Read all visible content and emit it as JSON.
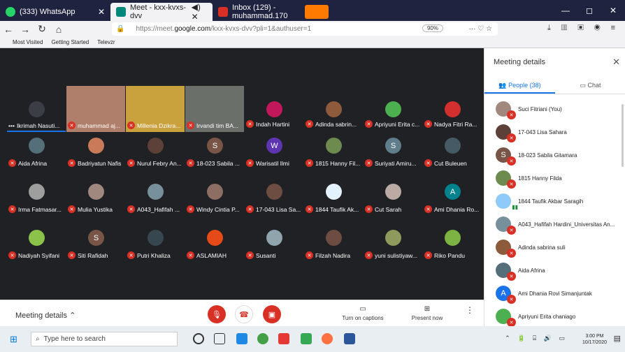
{
  "browser": {
    "tabs": [
      {
        "label": "(333) WhatsApp",
        "color": "#25d366"
      },
      {
        "label": "Meet - kxx-kvxs-dvv",
        "color": "#00897b"
      },
      {
        "label": "Inbox (129) - muhammad.170",
        "color": "#d93025"
      }
    ],
    "url_prefix": "https://meet.",
    "url_domain": "google.com",
    "url_suffix": "/kxx-kvxs-dvv?pli=1&authuser=1",
    "zoom": "90%",
    "bookmarks": [
      "Most Visited",
      "Getting Started",
      "Televzr"
    ]
  },
  "meeting": {
    "videos": [
      {
        "name": "Ikrimah Nasuti...",
        "color": "#3b3f45"
      },
      {
        "name": "muhammad aj...",
        "color": "#b07f6b"
      },
      {
        "name": "Millenia Dzikra...",
        "color": "#c9a23e"
      },
      {
        "name": "Irvandi tim BA...",
        "color": "#6b6f6a"
      }
    ],
    "tiles": [
      {
        "name": "Indah Hartini",
        "avatar": "",
        "color": "#c2185b"
      },
      {
        "name": "Adinda sabrin...",
        "avatar": "",
        "color": "#8d5a3b"
      },
      {
        "name": "Apriyuni Erita c...",
        "avatar": "",
        "color": "#4caf50"
      },
      {
        "name": "Nadya Fitri Ra...",
        "avatar": "",
        "color": "#d32f2f"
      },
      {
        "name": "Aida Afrina",
        "avatar": "",
        "color": "#546e7a"
      },
      {
        "name": "Badriyatun Nafis",
        "avatar": "",
        "color": "#c97b59"
      },
      {
        "name": "Nurul Febry An...",
        "avatar": "",
        "color": "#5d4037"
      },
      {
        "name": "18-023 Sabila ...",
        "avatar": "S",
        "color": "#795548"
      },
      {
        "name": "Warisatil Ilmi",
        "avatar": "W",
        "color": "#5e35b1"
      },
      {
        "name": "1815 Hanny Fil...",
        "avatar": "",
        "color": "#6d8a4f"
      },
      {
        "name": "Suriyati Amiru...",
        "avatar": "S",
        "color": "#607d8b"
      },
      {
        "name": "Cut Buleuen",
        "avatar": "",
        "color": "#455a64"
      },
      {
        "name": "Irma Fatmasar...",
        "avatar": "",
        "color": "#9e9e9e"
      },
      {
        "name": "Mulia Yustika",
        "avatar": "",
        "color": "#a1887f"
      },
      {
        "name": "A043_Hafifah ...",
        "avatar": "",
        "color": "#78909c"
      },
      {
        "name": "Windy Cintia P...",
        "avatar": "",
        "color": "#8d6e63"
      },
      {
        "name": "17-043 Lisa Sa...",
        "avatar": "",
        "color": "#6d4c41"
      },
      {
        "name": "1844 Taufik Ak...",
        "avatar": "",
        "color": "#e3f2fd"
      },
      {
        "name": "Cut Sarah",
        "avatar": "",
        "color": "#bcaaa4"
      },
      {
        "name": "Ami Dhania Ro...",
        "avatar": "A",
        "color": "#00838f"
      },
      {
        "name": "Nadiyah Syifani",
        "avatar": "",
        "color": "#8bc34a"
      },
      {
        "name": "Siti Rafidah",
        "avatar": "S",
        "color": "#795548"
      },
      {
        "name": "Putri Khaliza",
        "avatar": "",
        "color": "#37474f"
      },
      {
        "name": "ASLAMIAH",
        "avatar": "",
        "color": "#e64a19"
      },
      {
        "name": "Susanti",
        "avatar": "",
        "color": "#90a4ae"
      },
      {
        "name": "Filzah Nadira",
        "avatar": "",
        "color": "#6d4c41"
      },
      {
        "name": "yuni sulistiyaw...",
        "avatar": "",
        "color": "#8e9a5b"
      },
      {
        "name": "Riko Pandu",
        "avatar": "",
        "color": "#7cb342"
      }
    ]
  },
  "panel": {
    "title": "Meeting details",
    "people_tab": "People (38)",
    "chat_tab": "Chat",
    "people": [
      {
        "name": "Suci Fitriani (You)",
        "color": "#a1887f",
        "initial": ""
      },
      {
        "name": "17-043 Lisa Sahara",
        "color": "#5d4037",
        "initial": ""
      },
      {
        "name": "18-023 Sabila Gitamara",
        "color": "#795548",
        "initial": "S"
      },
      {
        "name": "1815 Hanny Filda",
        "color": "#6d8a4f",
        "initial": ""
      },
      {
        "name": "1844 Taufik Akbar Saragih",
        "color": "#90caf9",
        "initial": ""
      },
      {
        "name": "A043_Hafifah Hardini_Universitas An...",
        "color": "#78909c",
        "initial": ""
      },
      {
        "name": "Adinda sabrina suli",
        "color": "#8d5a3b",
        "initial": ""
      },
      {
        "name": "Aida Afrina",
        "color": "#546e7a",
        "initial": ""
      },
      {
        "name": "Ami Dhania Rovi Simanjuntak",
        "color": "#1a73e8",
        "initial": "A"
      },
      {
        "name": "Apriyuni Erita chaniago",
        "color": "#4caf50",
        "initial": ""
      }
    ]
  },
  "controls": {
    "meeting_details": "Meeting details",
    "captions": "Turn on captions",
    "present": "Present now"
  },
  "taskbar": {
    "search_placeholder": "Type here to search",
    "time": "3:00 PM",
    "date": "10/17/2020"
  }
}
